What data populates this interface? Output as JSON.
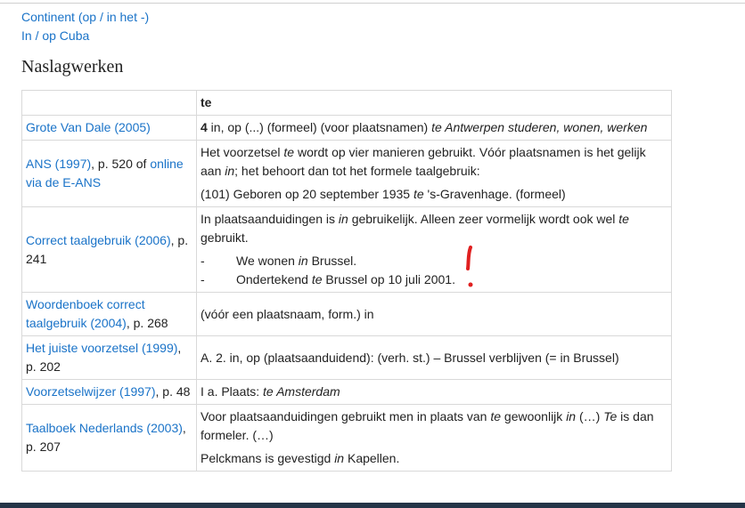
{
  "top_links": [
    "Continent (op / in het -)",
    "In / op Cuba"
  ],
  "section_title": "Naslagwerken",
  "table": {
    "header_col": "te",
    "rows": {
      "vandale": {
        "src_link": "Grote Van Dale (2005)",
        "num": "4",
        "t1": " in, op (...) (formeel) (voor plaatsnamen) ",
        "ex": "te Antwerpen studeren, wonen, werken"
      },
      "ans": {
        "src_link": "ANS (1997)",
        "src_mid": ", p. 520 of ",
        "src_link2": "online via de E-ANS",
        "p1a": "Het voorzetsel ",
        "p1b": "te",
        "p1c": " wordt op vier manieren gebruikt. Vóór plaatsnamen is het gelijk aan ",
        "p1d": "in",
        "p1e": "; het behoort dan tot het formele taalgebruik:",
        "p2a": "(101) Geboren op 20 september 1935 ",
        "p2b": "te",
        "p2c": " 's-Gravenhage. (formeel)"
      },
      "correct": {
        "src_link": "Correct taalgebruik (2006)",
        "src_rest": ", p. 241",
        "p1a": "In plaatsaanduidingen is ",
        "p1b": "in",
        "p1c": " gebruikelijk. Alleen zeer vormelijk wordt ook wel ",
        "p1d": "te",
        "p1e": " gebruikt.",
        "dash": "-",
        "li1a": "We wonen ",
        "li1b": "in",
        "li1c": " Brussel.",
        "li2a": "Ondertekend ",
        "li2b": "te",
        "li2c": " Brussel op 10 juli 2001."
      },
      "woordenboek": {
        "src_link": "Woordenboek correct taalgebruik (2004)",
        "src_rest": ", p. 268",
        "text": "(vóór een plaatsnaam, form.) in"
      },
      "juiste": {
        "src_link": "Het juiste voorzetsel (1999)",
        "src_rest": ", p. 202",
        "text": "A. 2. in, op (plaatsaanduidend): (verh. st.) – Brussel verblijven (= in Brussel)"
      },
      "wijzer": {
        "src_link": "Voorzetselwijzer (1997)",
        "src_rest": ", p. 48",
        "t1": "I a. Plaats: ",
        "t2": "te Amsterdam"
      },
      "taalboek": {
        "src_link": "Taalboek Nederlands (2003)",
        "src_rest": ", p. 207",
        "p1a": "Voor plaatsaanduidingen gebruikt men in plaats van ",
        "p1b": "te",
        "p1c": " gewoonlijk ",
        "p1d": "in",
        "p1e": " (…) ",
        "p1f": "Te",
        "p1g": " is dan formeler. (…)",
        "p2a": "Pelckmans is gevestigd ",
        "p2b": "in",
        "p2c": " Kapellen."
      }
    }
  },
  "annotation_color": "#e02020",
  "link_color": "#1a73c8",
  "bottom_bar_color": "#243447"
}
